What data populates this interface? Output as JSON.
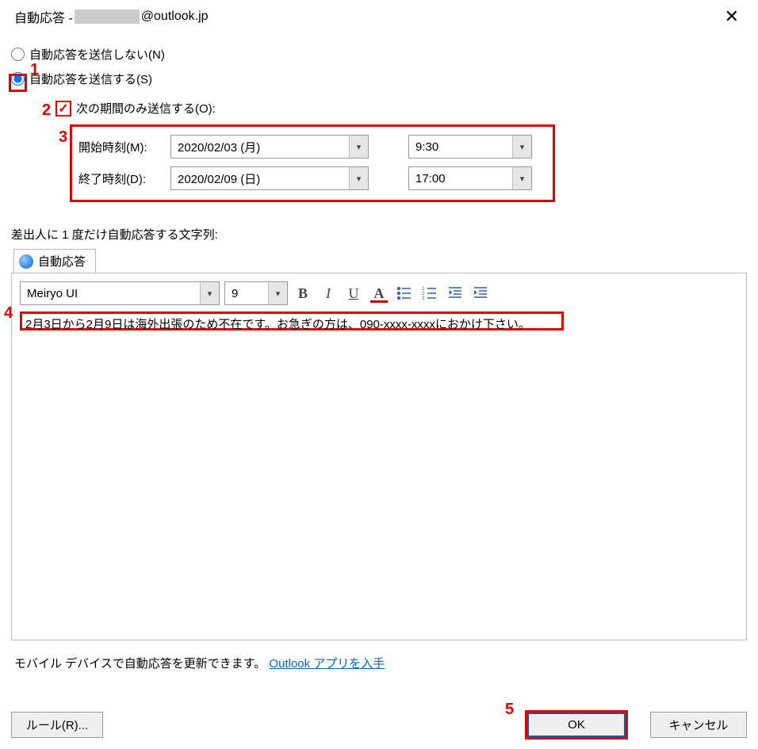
{
  "title": {
    "prefix": "自動応答 - ",
    "suffix": "@outlook.jp"
  },
  "radios": {
    "dont_send": "自動応答を送信しない(N)",
    "send": "自動応答を送信する(S)"
  },
  "checkbox": {
    "mark": "✓",
    "label": "次の期間のみ送信する(O):"
  },
  "time": {
    "start_label": "開始時刻(M):",
    "start_date": "2020/02/03 (月)",
    "start_time": "9:30",
    "end_label": "終了時刻(D):",
    "end_date": "2020/02/09 (日)",
    "end_time": "17:00"
  },
  "message_label": "差出人に 1 度だけ自動応答する文字列:",
  "tab_label": "自動応答",
  "toolbar": {
    "font": "Meiryo UI",
    "size": "9"
  },
  "message_body": "2月3日から2月9日は海外出張のため不在です。お急ぎの方は、090-xxxx-xxxxにおかけ下さい。",
  "mobile": {
    "text": "モバイル デバイスで自動応答を更新できます。",
    "link": "Outlook アプリを入手"
  },
  "buttons": {
    "rules": "ルール(R)...",
    "ok": "OK",
    "cancel": "キャンセル"
  },
  "annotations": {
    "n1": "1",
    "n2": "2",
    "n3": "3",
    "n4": "4",
    "n5": "5"
  }
}
